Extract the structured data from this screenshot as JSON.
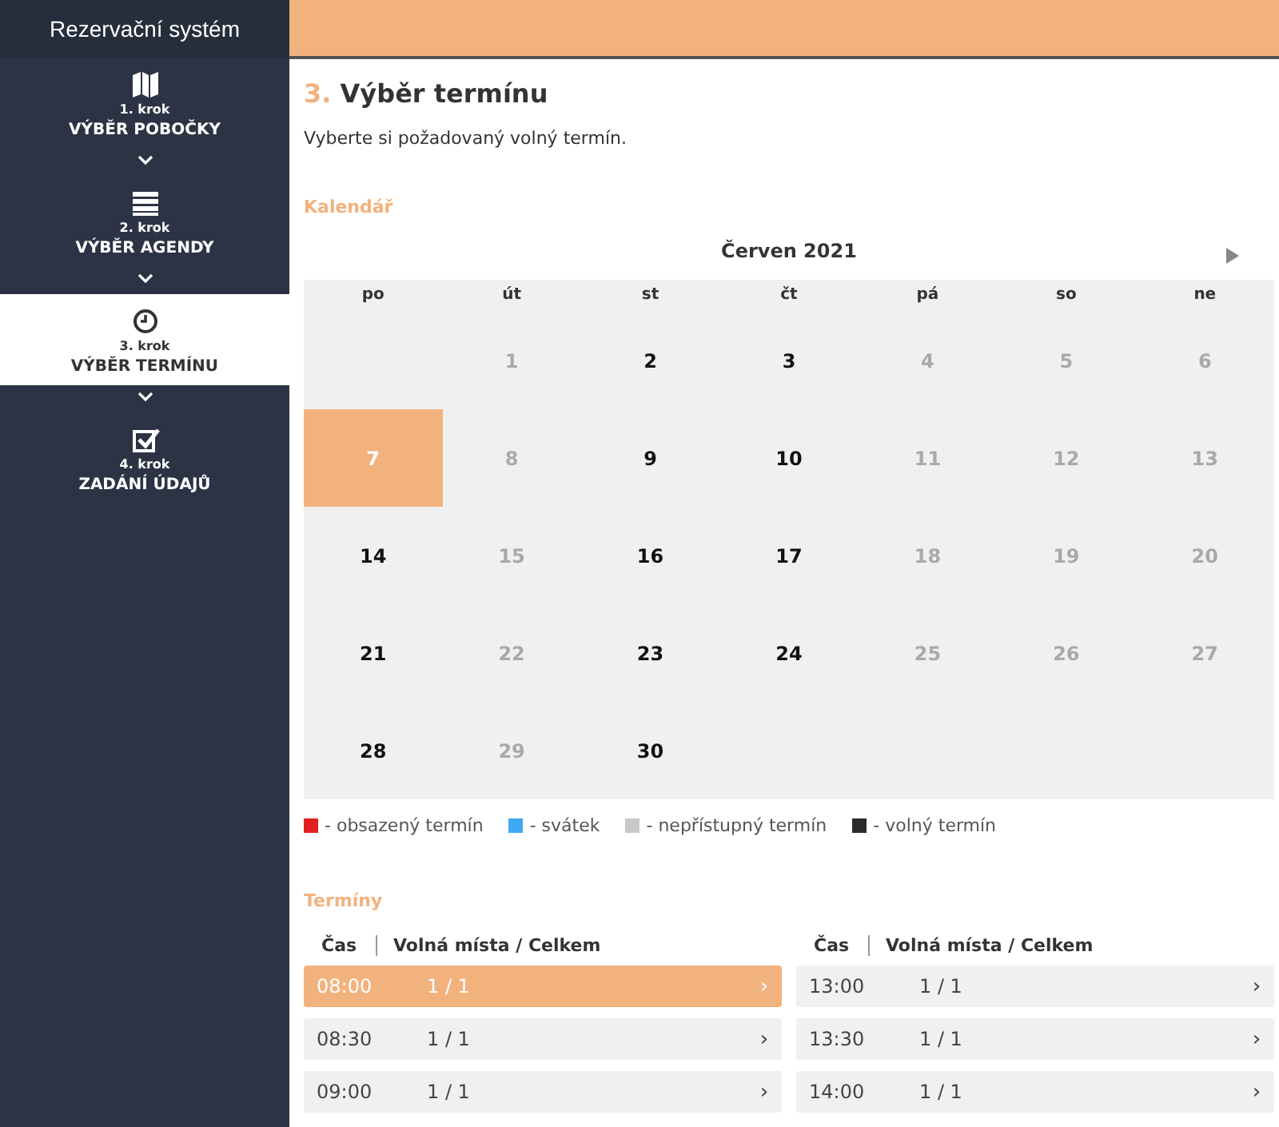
{
  "app_title": "Rezervační systém",
  "steps": [
    {
      "kind": "map",
      "number": "1. krok",
      "label": "VÝBĚR POBOČKY",
      "selected": false
    },
    {
      "kind": "list",
      "number": "2. krok",
      "label": "VÝBĚR AGENDY",
      "selected": false
    },
    {
      "kind": "clock",
      "number": "3. krok",
      "label": "VÝBĚR TERMÍNU",
      "selected": true
    },
    {
      "kind": "check",
      "number": "4. krok",
      "label": "ZADÁNÍ ÚDAJŮ",
      "selected": false
    }
  ],
  "page": {
    "step_number": "3.",
    "title": "Výběr termínu",
    "intro": "Vyberte si požadovaný volný termín."
  },
  "calendar": {
    "heading": "Kalendář",
    "month": "Červen 2021",
    "weekdays": [
      "po",
      "út",
      "st",
      "čt",
      "pá",
      "so",
      "ne"
    ],
    "weeks": [
      [
        {
          "kind": "blank"
        },
        {
          "kind": "unavailable",
          "day": "1",
          "selected": false
        },
        {
          "kind": "free",
          "day": "2",
          "selected": false
        },
        {
          "kind": "free",
          "day": "3",
          "selected": false
        },
        {
          "kind": "unavailable",
          "day": "4",
          "selected": false
        },
        {
          "kind": "unavailable",
          "day": "5",
          "selected": false
        },
        {
          "kind": "unavailable",
          "day": "6",
          "selected": false
        }
      ],
      [
        {
          "kind": "free",
          "day": "7",
          "selected": true
        },
        {
          "kind": "unavailable",
          "day": "8",
          "selected": false
        },
        {
          "kind": "free",
          "day": "9",
          "selected": false
        },
        {
          "kind": "free",
          "day": "10",
          "selected": false
        },
        {
          "kind": "unavailable",
          "day": "11",
          "selected": false
        },
        {
          "kind": "unavailable",
          "day": "12",
          "selected": false
        },
        {
          "kind": "unavailable",
          "day": "13",
          "selected": false
        }
      ],
      [
        {
          "kind": "free",
          "day": "14",
          "selected": false
        },
        {
          "kind": "unavailable",
          "day": "15",
          "selected": false
        },
        {
          "kind": "free",
          "day": "16",
          "selected": false
        },
        {
          "kind": "free",
          "day": "17",
          "selected": false
        },
        {
          "kind": "unavailable",
          "day": "18",
          "selected": false
        },
        {
          "kind": "unavailable",
          "day": "19",
          "selected": false
        },
        {
          "kind": "unavailable",
          "day": "20",
          "selected": false
        }
      ],
      [
        {
          "kind": "free",
          "day": "21",
          "selected": false
        },
        {
          "kind": "unavailable",
          "day": "22",
          "selected": false
        },
        {
          "kind": "free",
          "day": "23",
          "selected": false
        },
        {
          "kind": "free",
          "day": "24",
          "selected": false
        },
        {
          "kind": "unavailable",
          "day": "25",
          "selected": false
        },
        {
          "kind": "unavailable",
          "day": "26",
          "selected": false
        },
        {
          "kind": "unavailable",
          "day": "27",
          "selected": false
        }
      ],
      [
        {
          "kind": "free",
          "day": "28",
          "selected": false
        },
        {
          "kind": "unavailable",
          "day": "29",
          "selected": false
        },
        {
          "kind": "free",
          "day": "30",
          "selected": false
        },
        {
          "kind": "blank"
        },
        {
          "kind": "blank"
        },
        {
          "kind": "blank"
        },
        {
          "kind": "blank"
        }
      ]
    ],
    "legend": [
      {
        "color": "#e02020",
        "label": "- obsazený termín"
      },
      {
        "color": "#3fa9f5",
        "label": "- svátek"
      },
      {
        "color": "#c8c8c8",
        "label": "- nepřístupný termín"
      },
      {
        "color": "#2b2b2b",
        "label": "- volný termín"
      }
    ]
  },
  "slots": {
    "heading": "Termíny",
    "columns": [
      {
        "time_header": "Čas",
        "places_header": "Volná místa / Celkem",
        "rows": [
          {
            "time": "08:00",
            "places": "1 / 1",
            "arrow": "›",
            "selected": true
          },
          {
            "time": "08:30",
            "places": "1 / 1",
            "arrow": "›",
            "selected": false
          },
          {
            "time": "09:00",
            "places": "1 / 1",
            "arrow": "›",
            "selected": false
          }
        ]
      },
      {
        "time_header": "Čas",
        "places_header": "Volná místa / Celkem",
        "rows": [
          {
            "time": "13:00",
            "places": "1 / 1",
            "arrow": "›",
            "selected": false
          },
          {
            "time": "13:30",
            "places": "1 / 1",
            "arrow": "›",
            "selected": false
          },
          {
            "time": "14:00",
            "places": "1 / 1",
            "arrow": "›",
            "selected": false
          }
        ]
      }
    ]
  }
}
